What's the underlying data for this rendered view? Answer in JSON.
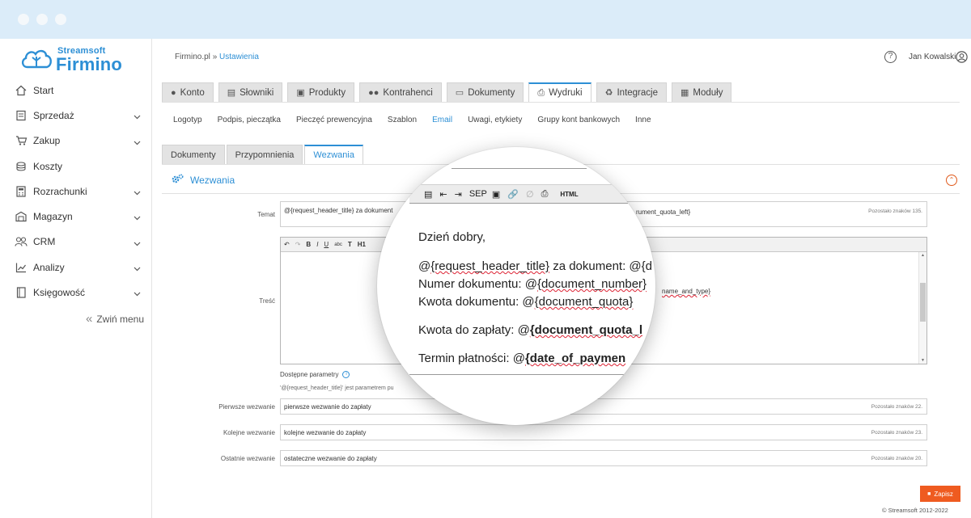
{
  "app": {
    "brand_small": "Streamsoft",
    "brand_main": "Firmino",
    "accent_color": "#2d8fd5",
    "action_color": "#ef5b20"
  },
  "sidebar": {
    "items": [
      {
        "label": "Start",
        "icon": "home-icon",
        "has_submenu": false
      },
      {
        "label": "Sprzedaż",
        "icon": "register-icon",
        "has_submenu": true
      },
      {
        "label": "Zakup",
        "icon": "cart-icon",
        "has_submenu": true
      },
      {
        "label": "Koszty",
        "icon": "coins-icon",
        "has_submenu": false
      },
      {
        "label": "Rozrachunki",
        "icon": "calculator-icon",
        "has_submenu": true
      },
      {
        "label": "Magazyn",
        "icon": "warehouse-icon",
        "has_submenu": true
      },
      {
        "label": "CRM",
        "icon": "users-icon",
        "has_submenu": true
      },
      {
        "label": "Analizy",
        "icon": "chart-icon",
        "has_submenu": true
      },
      {
        "label": "Księgowość",
        "icon": "book-icon",
        "has_submenu": true
      }
    ],
    "collapse_label": "Zwiń menu"
  },
  "header": {
    "breadcrumb_root": "Firmino.pl",
    "breadcrumb_sep": "»",
    "breadcrumb_current": "Ustawienia",
    "user_name": "Jan Kowalski"
  },
  "main_tabs": [
    {
      "label": "Konto",
      "icon": "user-icon"
    },
    {
      "label": "Słowniki",
      "icon": "list-icon"
    },
    {
      "label": "Produkty",
      "icon": "box-icon"
    },
    {
      "label": "Kontrahenci",
      "icon": "group-icon"
    },
    {
      "label": "Dokumenty",
      "icon": "file-icon"
    },
    {
      "label": "Wydruki",
      "icon": "print-icon",
      "active": true
    },
    {
      "label": "Integracje",
      "icon": "plug-icon"
    },
    {
      "label": "Moduły",
      "icon": "grid-icon"
    }
  ],
  "sub_tabs": [
    "Logotyp",
    "Podpis, pieczątka",
    "Pieczęć prewencyjna",
    "Szablon",
    "Email",
    "Uwagi, etykiety",
    "Grupy kont bankowych",
    "Inne"
  ],
  "sub_tabs_active": "Email",
  "third_tabs": [
    "Dokumenty",
    "Przypomnienia",
    "Wezwania"
  ],
  "third_tabs_active": "Wezwania",
  "section": {
    "title": "Wezwania"
  },
  "form": {
    "temat": {
      "label": "Temat",
      "value": "@{request_header_title} za dokument",
      "value_tail": "rument_quota_left}",
      "remaining": "Pozostało znaków 135."
    },
    "tresc": {
      "label": "Treść",
      "peek_tail": "name_and_type}"
    },
    "params_label": "Dostępne parametry",
    "params_note": "'@{request_header_title}' jest parametrem pu",
    "fields": [
      {
        "label": "Pierwsze wezwanie",
        "value": "pierwsze wezwanie do zapłaty",
        "remaining": "Pozostało znaków 22."
      },
      {
        "label": "Kolejne wezwanie",
        "value": "kolejne wezwanie do zapłaty",
        "remaining": "Pozostało znaków 23."
      },
      {
        "label": "Ostatnie wezwanie",
        "value": "ostateczne wezwanie do zapłaty",
        "remaining": "Pozostało znaków 20."
      }
    ]
  },
  "magnifier": {
    "toolbar_sep": "SEP",
    "toolbar_html": "HTML",
    "greeting": "Dzień dobry,",
    "line1_prefix": "@",
    "line1_param": "{request_header_title}",
    "line1_suffix": " za dokument: @{d",
    "line2_label": "Numer dokumentu: @",
    "line2_param": "{document_number}",
    "line3_label": "Kwota dokumentu: @",
    "line3_param": "{document_quota}",
    "line4_label": "Kwota do zapłaty: @",
    "line4_param": "{document_quota_l",
    "line5_label": "Termin płatności: @",
    "line5_param": "{date_of_paymen"
  },
  "actions": {
    "save_label": "Zapisz"
  },
  "footer": {
    "copyright": "© Streamsoft 2012-2022"
  }
}
